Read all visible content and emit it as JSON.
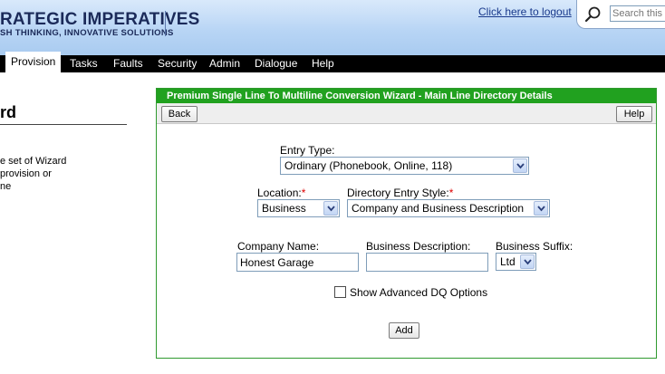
{
  "header": {
    "brand_title": "RATEGIC IMPERATIVES",
    "brand_tagline": "SH THINKING, INNOVATIVE SOLUTIONS",
    "logout_link": "Click here to logout",
    "search_placeholder": "Search this p"
  },
  "nav": {
    "items": [
      "Provision",
      "Tasks",
      "Faults",
      "Security",
      "Admin",
      "Dialogue",
      "Help"
    ],
    "active": "Provision"
  },
  "left": {
    "title": "rd",
    "lines": [
      "e set of Wizard",
      "provision or",
      "ne"
    ]
  },
  "wizard": {
    "title": "Premium Single Line To Multiline Conversion Wizard - Main Line Directory Details",
    "back_label": "Back",
    "help_label": "Help",
    "entry_type_label": "Entry Type:",
    "entry_type_value": "Ordinary (Phonebook, Online, 118)",
    "location_label": "Location:",
    "location_value": "Business",
    "style_label": "Directory Entry Style:",
    "style_value": "Company and Business Description",
    "required_marker": "*",
    "company_label": "Company Name:",
    "company_value": "Honest Garage",
    "business_desc_label": "Business Description:",
    "business_desc_value": "",
    "suffix_label": "Business Suffix:",
    "suffix_value": "Ltd",
    "advanced_label": "Show Advanced DQ Options",
    "advanced_checked": false,
    "add_label": "Add"
  },
  "colors": {
    "panel_header": "#21a11f",
    "brand_navy": "#1b2a59",
    "nav_bg": "#000000",
    "required": "#dd0000"
  }
}
